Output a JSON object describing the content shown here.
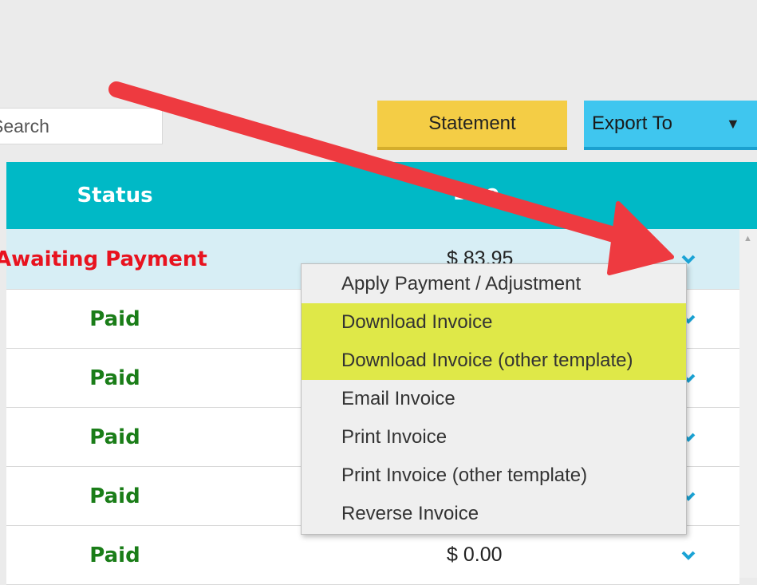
{
  "toolbar": {
    "search_placeholder": "Search",
    "statement_label": "Statement",
    "export_label": "Export To",
    "export_caret": "▼"
  },
  "table": {
    "columns": {
      "status": "Status",
      "due": "Due"
    },
    "rows": [
      {
        "status": "Awaiting Payment",
        "due": "$ 83.95",
        "state": "awaiting"
      },
      {
        "status": "Paid",
        "due": ""
      },
      {
        "status": "Paid",
        "due": ""
      },
      {
        "status": "Paid",
        "due": ""
      },
      {
        "status": "Paid",
        "due": ""
      },
      {
        "status": "Paid",
        "due": "$ 0.00"
      }
    ]
  },
  "row_menu": {
    "items": [
      {
        "label": "Apply Payment / Adjustment",
        "highlighted": false
      },
      {
        "label": "Download Invoice",
        "highlighted": true
      },
      {
        "label": "Download Invoice (other template)",
        "highlighted": true
      },
      {
        "label": "Email Invoice",
        "highlighted": false
      },
      {
        "label": "Print Invoice",
        "highlighted": false
      },
      {
        "label": "Print Invoice (other template)",
        "highlighted": false
      },
      {
        "label": "Reverse Invoice",
        "highlighted": false
      }
    ]
  },
  "icons": {
    "row_action": "chevron-down-icon",
    "scroll_up": "scroll-up-arrow-icon",
    "annotation": "red-arrow-annotation"
  },
  "colors": {
    "header": "#00b9c6",
    "statement_button": "#f4cd45",
    "export_button": "#3fc6ef",
    "awaiting": "#e8131f",
    "paid": "#1a7d18",
    "highlight": "#dfe848",
    "arrow": "#ee3a40"
  }
}
